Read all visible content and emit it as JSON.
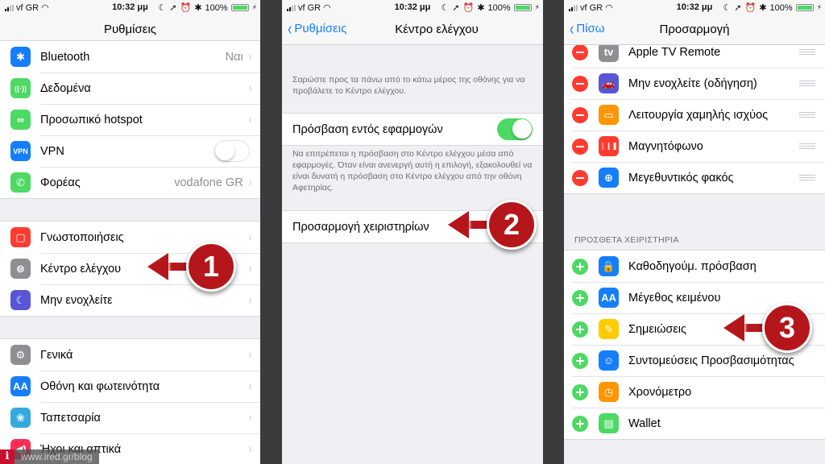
{
  "status_bar": {
    "carrier": "vf GR",
    "time": "10:32 μμ",
    "battery": "100%"
  },
  "panel1": {
    "title": "Ρυθμίσεις",
    "group1": [
      {
        "icon": "bluetooth-icon",
        "glyph": "✱",
        "color": "#157efb",
        "label": "Bluetooth",
        "value": "Ναι",
        "accessory": "chevron"
      },
      {
        "icon": "cellular-data-icon",
        "glyph": "((·))",
        "color": "#4cd964",
        "label": "Δεδομένα",
        "value": "",
        "accessory": "chevron"
      },
      {
        "icon": "hotspot-icon",
        "glyph": "∞",
        "color": "#4cd964",
        "label": "Προσωπικό hotspot",
        "value": "",
        "accessory": "chevron"
      },
      {
        "icon": "vpn-icon",
        "glyph": "VPN",
        "color": "#157efb",
        "label": "VPN",
        "value": "",
        "accessory": "switch-off"
      },
      {
        "icon": "phone-icon",
        "glyph": "✆",
        "color": "#4cd964",
        "label": "Φορέας",
        "value": "vodafone GR",
        "accessory": "chevron"
      }
    ],
    "group2": [
      {
        "icon": "notifications-icon",
        "glyph": "▢",
        "color": "#ff3b30",
        "label": "Γνωστοποιήσεις"
      },
      {
        "icon": "control-center-icon",
        "glyph": "⊜",
        "color": "#8e8e93",
        "label": "Κέντρο ελέγχου"
      },
      {
        "icon": "do-not-disturb-icon",
        "glyph": "☾",
        "color": "#5856d6",
        "label": "Μην ενοχλείτε"
      }
    ],
    "group3": [
      {
        "icon": "general-gear-icon",
        "glyph": "⚙",
        "color": "#8e8e93",
        "label": "Γενικά"
      },
      {
        "icon": "display-brightness-icon",
        "glyph": "AA",
        "color": "#157efb",
        "label": "Οθόνη και φωτεινότητα"
      },
      {
        "icon": "wallpaper-icon",
        "glyph": "❀",
        "color": "#34aadc",
        "label": "Ταπετσαρία"
      },
      {
        "icon": "sounds-icon",
        "glyph": "◀)",
        "color": "#ff2d55",
        "label": "Ήχοι και απτικά"
      }
    ],
    "callout": "1"
  },
  "panel2": {
    "back": "Ρυθμίσεις",
    "title": "Κέντρο ελέγχου",
    "intro": "Σαρώστε προς τα πάνω από το κάτω μέρος της οθόνης για να προβάλετε το Κέντρο ελέγχου.",
    "access_label": "Πρόσβαση εντός εφαρμογών",
    "access_on": true,
    "access_note": "Να επιτρέπεται η πρόσβαση στο Κέντρο ελέγχου μέσα από εφαρμογές. Όταν είναι ανενεργή αυτή η επιλογή, εξακολουθεί να είναι δυνατή η πρόσβαση στο Κέντρο ελέγχου από την οθόνη Αφετηρίας.",
    "customize_label": "Προσαρμογή χειριστηρίων",
    "callout": "2"
  },
  "panel3": {
    "back": "Πίσω",
    "title": "Προσαρμογή",
    "included": [
      {
        "icon": "apple-tv-icon",
        "glyph": "tv",
        "color": "#8e8e93",
        "label": "Apple TV Remote"
      },
      {
        "icon": "car-icon",
        "glyph": "🚗",
        "color": "#5856d6",
        "label": "Μην ενοχλείτε (οδήγηση)"
      },
      {
        "icon": "low-power-battery-icon",
        "glyph": "▭",
        "color": "#ff9500",
        "label": "Λειτουργία χαμηλής ισχύος"
      },
      {
        "icon": "voice-memos-icon",
        "glyph": "❘❙❚",
        "color": "#ff3b30",
        "label": "Μαγνητόφωνο"
      },
      {
        "icon": "magnifier-icon",
        "glyph": "⊕",
        "color": "#157efb",
        "label": "Μεγεθυντικός φακός"
      }
    ],
    "more_header": "ΠΡΟΣΘΕΤΑ ΧΕΙΡΙΣΤΗΡΙΑ",
    "more": [
      {
        "icon": "guided-access-lock-icon",
        "glyph": "🔒",
        "color": "#157efb",
        "label": "Καθοδηγούμ. πρόσβαση"
      },
      {
        "icon": "text-size-icon",
        "glyph": "AA",
        "color": "#157efb",
        "label": "Μέγεθος κειμένου"
      },
      {
        "icon": "notes-icon",
        "glyph": "✎",
        "color": "#ffcc00",
        "label": "Σημειώσεις"
      },
      {
        "icon": "accessibility-icon",
        "glyph": "☺",
        "color": "#157efb",
        "label": "Συντομεύσεις Προσβασιμότητας"
      },
      {
        "icon": "stopwatch-icon",
        "glyph": "◷",
        "color": "#ff9500",
        "label": "Χρονόμετρο"
      },
      {
        "icon": "wallet-icon",
        "glyph": "▤",
        "color": "#4cd964",
        "label": "Wallet"
      }
    ],
    "callout": "3"
  },
  "watermark": {
    "logo": "i",
    "url": "www.ired.gr/blog"
  }
}
